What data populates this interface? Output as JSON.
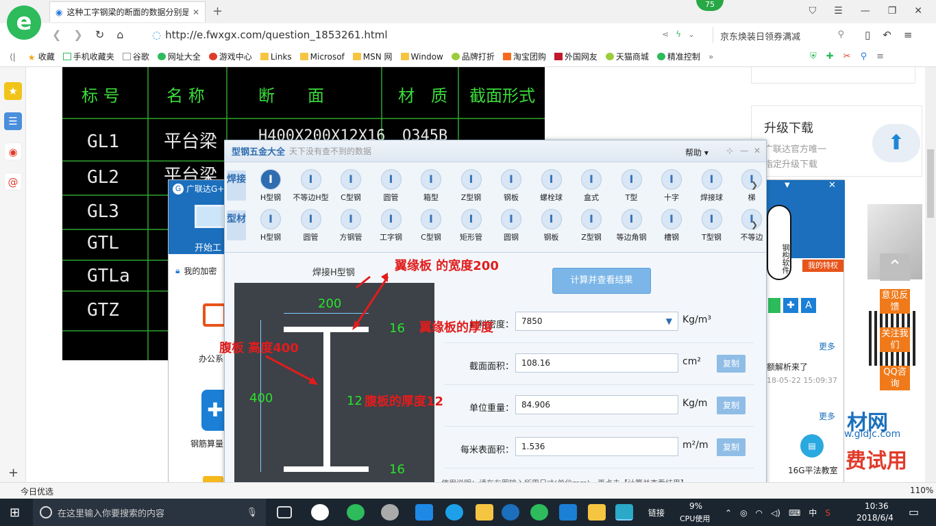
{
  "browser": {
    "tab_title": "这种工字钢梁的断面的数据分别是",
    "url": "http://e.fwxgx.com/question_1853261.html",
    "search_hint": "京东焕装日领券满减",
    "badge": "75",
    "bookmarks": [
      "收藏",
      "手机收藏夹",
      "谷歌",
      "网址大全",
      "游戏中心",
      "Links",
      "Microsof",
      "MSN 网",
      "Window",
      "品牌打折",
      "淘宝团购",
      "外国网友",
      "天猫商城",
      "精准控制"
    ],
    "status_left": "今日优选",
    "zoom": "110%"
  },
  "cad": {
    "headers": [
      "标 号",
      "名 称",
      "断　　面",
      "材　质",
      "截面形式"
    ],
    "rows": [
      [
        "GL1",
        "平台梁",
        "H400X200X12X16",
        "Q345B"
      ],
      [
        "GL2",
        "平台梁"
      ],
      [
        "GL3"
      ],
      [
        "GTL"
      ],
      [
        "GTLa"
      ],
      [
        "GTZ"
      ]
    ]
  },
  "back_dialog": {
    "title": "广联达G+",
    "start": "开始工作",
    "encrypt": "我的加密",
    "office": "办公系",
    "rebar": "钢筋算量"
  },
  "app": {
    "title": "型钢五金大全",
    "slogan": "天下没有查不到的数据",
    "help": "帮助",
    "cat_weld": "焊接",
    "cat_profile": "型材",
    "weld_items": [
      "H型钢",
      "不等边H型",
      "C型钢",
      "圆管",
      "箱型",
      "Z型钢",
      "钢板",
      "螺栓球",
      "盒式",
      "T型",
      "十字",
      "焊接球",
      "梯"
    ],
    "profile_items": [
      "H型钢",
      "圆管",
      "方钢管",
      "工字钢",
      "C型钢",
      "矩形管",
      "圆钢",
      "钢板",
      "Z型钢",
      "等边角钢",
      "槽钢",
      "T型钢",
      "不等边"
    ],
    "drawing_title": "焊接H型钢",
    "calc_button": "计算并查看结果",
    "fields": [
      {
        "label": "材料密度：",
        "value": "7850",
        "unit": "Kg/m³",
        "copy": ""
      },
      {
        "label": "截面面积：",
        "value": "108.16",
        "unit": "cm²",
        "copy": "复制"
      },
      {
        "label": "单位重量：",
        "value": "84.906",
        "unit": "Kg/m",
        "copy": "复制"
      },
      {
        "label": "每米表面积：",
        "value": "1.536",
        "unit": "m²/m",
        "copy": "复制"
      }
    ],
    "usage": "使用说明：请在左图输入所需尺寸(单位mm)，再点击【计算并查看结果】",
    "dims": {
      "width": "200",
      "flange_t": "16",
      "height": "400",
      "web_t": "12",
      "flange_b": "16"
    },
    "annotations": {
      "flange_width": "翼缘板 的宽度200",
      "flange_thick": "翼缘板的厚度",
      "web_height": "腹板 高度400",
      "web_thick": "腹板的厚度12"
    }
  },
  "right_panel": {
    "upgrade_title": "升级下载",
    "upgrade_desc1": "广联达官方唯一",
    "upgrade_desc2": "指定升级下载",
    "my_priv": "我的特权",
    "more": "更多",
    "news": "额解析来了",
    "date": "18-05-22 15:09:37",
    "site": "材网",
    "site_url": "w.gldjc.com",
    "class": "16G平法教室",
    "trial": "费试用",
    "mascot": "钢构软件",
    "float": [
      "意见反馈",
      "关注我们",
      "QQ咨询"
    ]
  },
  "taskbar": {
    "search_placeholder": "在这里输入你要搜索的内容",
    "cpu": "9%",
    "cpu_label": "CPU使用",
    "link": "链接",
    "ime": "中",
    "time": "10:36",
    "date": "2018/6/4"
  }
}
